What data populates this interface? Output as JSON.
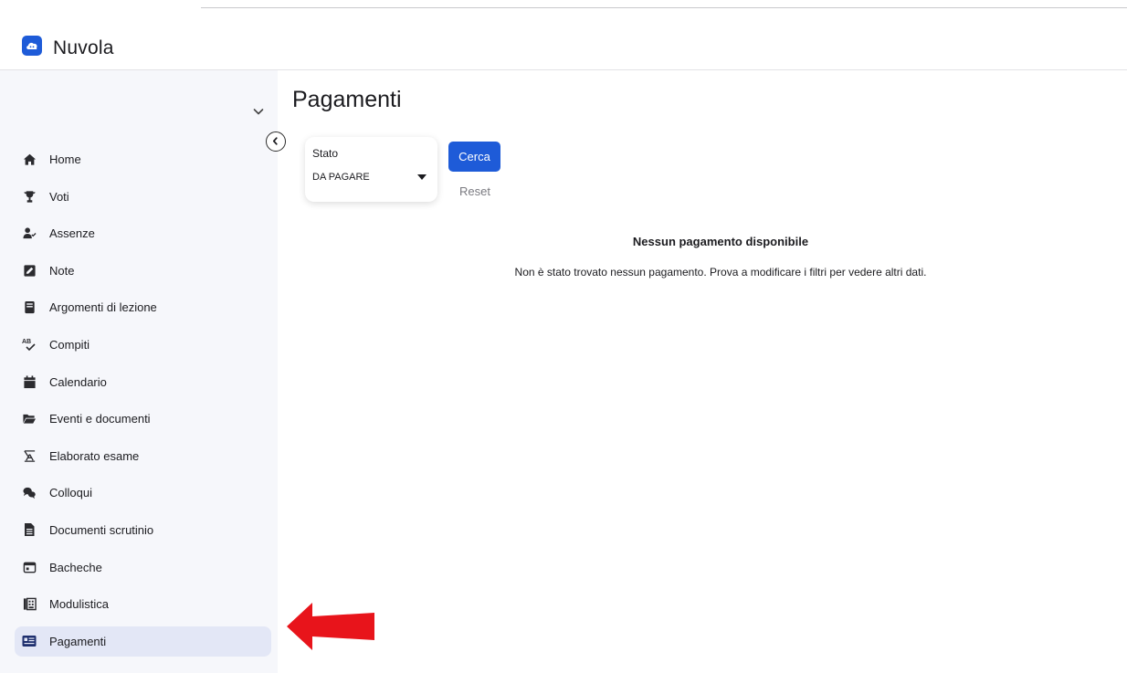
{
  "app": {
    "title": "Nuvola"
  },
  "sidebar": {
    "items": [
      {
        "label": "Home",
        "icon": "home-icon"
      },
      {
        "label": "Voti",
        "icon": "trophy-icon"
      },
      {
        "label": "Assenze",
        "icon": "user-check-icon"
      },
      {
        "label": "Note",
        "icon": "note-icon"
      },
      {
        "label": "Argomenti di lezione",
        "icon": "book-icon"
      },
      {
        "label": "Compiti",
        "icon": "spellcheck-icon"
      },
      {
        "label": "Calendario",
        "icon": "calendar-icon"
      },
      {
        "label": "Eventi e documenti",
        "icon": "folder-icon"
      },
      {
        "label": "Elaborato esame",
        "icon": "compass-icon"
      },
      {
        "label": "Colloqui",
        "icon": "chat-icon"
      },
      {
        "label": "Documenti scrutinio",
        "icon": "document-icon"
      },
      {
        "label": "Bacheche",
        "icon": "board-icon"
      },
      {
        "label": "Modulistica",
        "icon": "forms-icon"
      },
      {
        "label": "Pagamenti",
        "icon": "id-card-icon",
        "active": true
      }
    ]
  },
  "main": {
    "title": "Pagamenti",
    "filter": {
      "label": "Stato",
      "value": "DA PAGARE"
    },
    "search_label": "Cerca",
    "reset_label": "Reset",
    "empty_title": "Nessun pagamento disponibile",
    "empty_desc": "Non è stato trovato nessun pagamento. Prova a modificare i filtri per vedere altri dati."
  },
  "colors": {
    "accent": "#1e5bd8",
    "sidebar_bg": "#f6f7fb",
    "active_bg": "#e3e7f6",
    "arrow": "#e8141b"
  }
}
